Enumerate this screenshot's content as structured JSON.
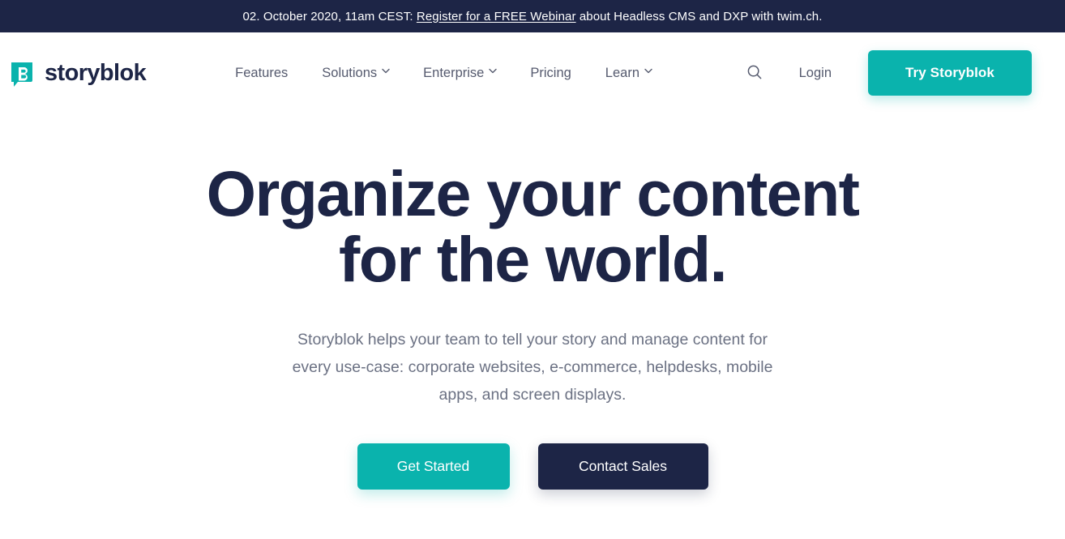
{
  "announcement": {
    "prefix": "02. October 2020, 11am CEST: ",
    "link_label": "Register for a FREE Webinar",
    "suffix": " about Headless CMS and DXP with twim.ch.",
    "background_color": "#1d2546",
    "text_color": "#ffffff"
  },
  "header": {
    "brand_name": "storyblok",
    "brand_mark_letter": "B",
    "nav_items": [
      {
        "label": "Features",
        "has_dropdown": false
      },
      {
        "label": "Solutions",
        "has_dropdown": true
      },
      {
        "label": "Enterprise",
        "has_dropdown": true
      },
      {
        "label": "Pricing",
        "has_dropdown": false
      },
      {
        "label": "Learn",
        "has_dropdown": true
      }
    ],
    "search_icon": "search-icon",
    "login_label": "Login",
    "cta_label": "Try Storyblok"
  },
  "hero": {
    "title_line1": "Organize your content",
    "title_line2": "for the world.",
    "subtitle": "Storyblok helps your team to tell your story and manage content for every use-case: corporate websites, e-commerce, helpdesks, mobile apps, and screen displays.",
    "primary_cta": "Get Started",
    "secondary_cta": "Contact Sales"
  },
  "colors": {
    "accent_teal": "#0ab3ad",
    "navy": "#1d2546",
    "body_gray": "#6b7183",
    "nav_gray": "#555a6e",
    "page_background": "#ffffff"
  }
}
